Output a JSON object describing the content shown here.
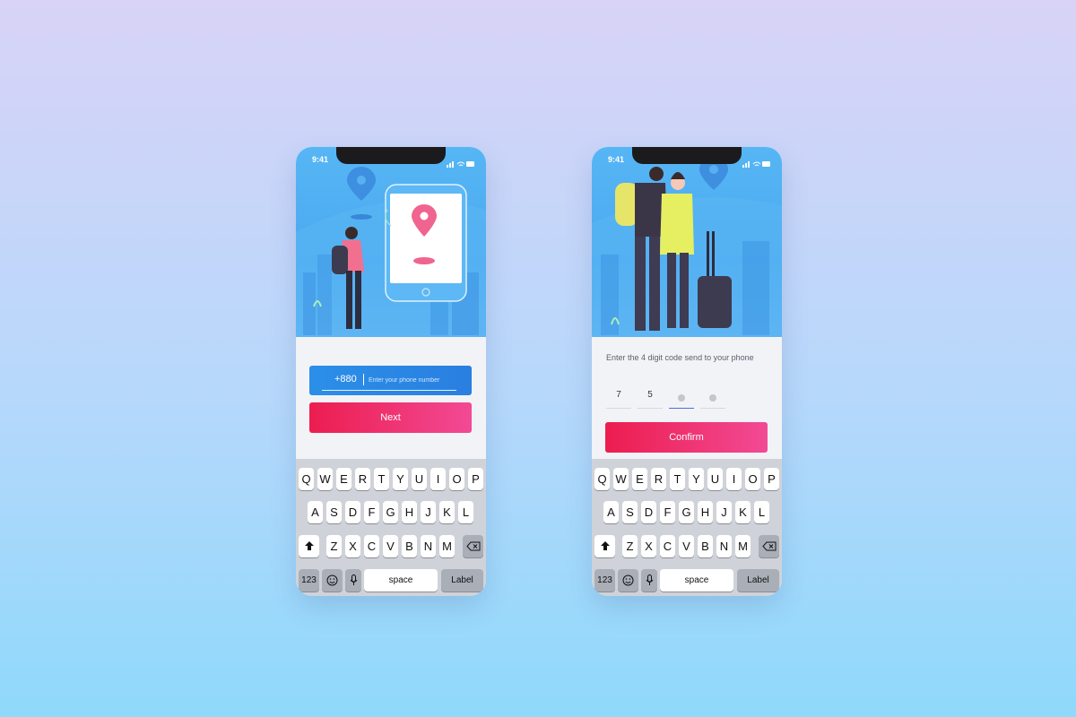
{
  "phones": [
    {
      "status_time": "9:41",
      "phone_input": {
        "country_code": "+880",
        "placeholder": "Enter your phone number"
      },
      "next_label": "Next"
    },
    {
      "status_time": "9:41",
      "prompt": "Enter the 4 digit code send to your phone",
      "digits": [
        "7",
        "5",
        "",
        ""
      ],
      "confirm_label": "Confirm"
    }
  ],
  "keyboard": {
    "row1": [
      "Q",
      "W",
      "E",
      "R",
      "T",
      "Y",
      "U",
      "I",
      "O",
      "P"
    ],
    "row2": [
      "A",
      "S",
      "D",
      "F",
      "G",
      "H",
      "J",
      "K",
      "L"
    ],
    "row3": [
      "Z",
      "X",
      "C",
      "V",
      "B",
      "N",
      "M"
    ],
    "numbers_label": "123",
    "space_label": "space",
    "return_label": "Label"
  },
  "colors": {
    "primary_gradient": [
      "#ec1d4f",
      "#f24a95"
    ],
    "field_blue": "#2a86e4",
    "hero_blue": "#4ba9f0",
    "pin": "#f0658f"
  }
}
